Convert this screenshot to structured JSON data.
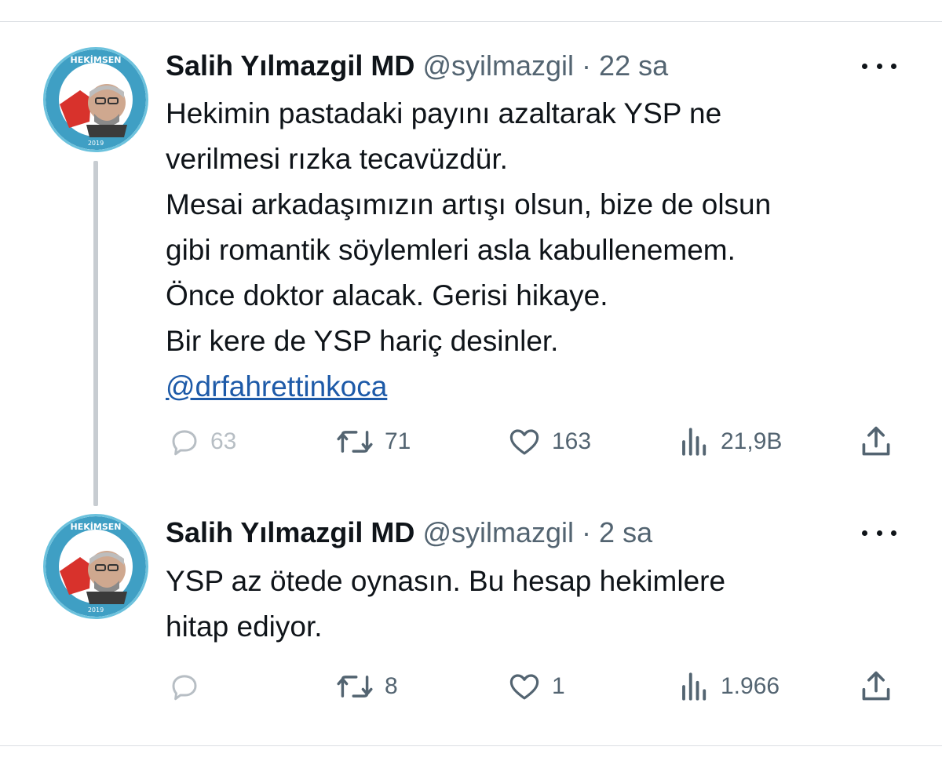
{
  "tweets": [
    {
      "author_name": "Salih Yılmazgil MD",
      "handle": "@syilmazgil",
      "separator": "·",
      "time": "22 sa",
      "lines": [
        "Hekimin pastadaki payını azaltarak YSP ne",
        "verilmesi rızka tecavüzdür.",
        "Mesai arkadaşımızın artışı olsun, bize de olsun",
        "gibi romantik söylemleri asla kabullenemem.",
        "Önce doktor alacak. Gerisi hikaye.",
        "Bir kere de YSP hariç desinler."
      ],
      "mention": "@drfahrettinkoca",
      "replies": "63",
      "retweets": "71",
      "likes": "163",
      "views": "21,9B"
    },
    {
      "author_name": "Salih Yılmazgil MD",
      "handle": "@syilmazgil",
      "separator": "·",
      "time": "2 sa",
      "lines": [
        "YSP az ötede oynasın. Bu hesap hekimlere",
        "hitap ediyor."
      ],
      "replies": "",
      "retweets": "8",
      "likes": "1",
      "views": "1.966"
    }
  ],
  "avatar": {
    "badge_text": "HEKİMSEN",
    "badge_year": "2019",
    "ring_color": "#3f9fc4",
    "accent_color": "#d8322c"
  },
  "icons": [
    "reply-icon",
    "retweet-icon",
    "like-icon",
    "views-icon",
    "share-icon",
    "more-icon"
  ],
  "colors": {
    "text": "#0f1419",
    "muted": "#536471",
    "link": "#1d5aa8",
    "thread_line": "#c7ccd1"
  }
}
